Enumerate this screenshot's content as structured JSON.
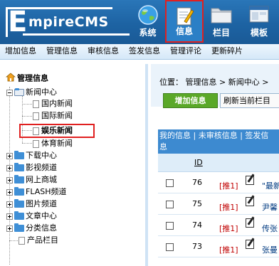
{
  "brand": {
    "logo_initial": "E",
    "logo_text": "mpireCMS"
  },
  "top_nav": [
    {
      "label": "系统",
      "icon": "globe-icon"
    },
    {
      "label": "信息",
      "icon": "notepad-icon",
      "active": true
    },
    {
      "label": "栏目",
      "icon": "folder-icon"
    },
    {
      "label": "模板",
      "icon": "window-icon"
    }
  ],
  "sub_menu": [
    "增加信息",
    "管理信息",
    "审核信息",
    "签发信息",
    "管理评论",
    "更新碎片"
  ],
  "tree": {
    "root_label": "管理信息",
    "news_center": "新闻中心",
    "news_children": [
      "国内新闻",
      "国际新闻",
      "娱乐新闻",
      "体育新闻"
    ],
    "selected": "娱乐新闻",
    "folders": [
      "下载中心",
      "影视频道",
      "网上商城",
      "FLASH频道",
      "图片频道",
      "文章中心",
      "分类信息"
    ],
    "last_item": "产品栏目"
  },
  "right": {
    "location": "位置： 管理信息 > 新闻中心 >",
    "add_button": "增加信息",
    "refresh_button": "刷新当前栏目",
    "tabs_line1": "我的信息 | 未审核信息 | 签发信",
    "tabs_line2": "息",
    "id_header": "ID",
    "rows": [
      {
        "id": "76",
        "tag": "[推1]",
        "title": "\"最新"
      },
      {
        "id": "75",
        "tag": "[推1]",
        "title": "尹馨"
      },
      {
        "id": "74",
        "tag": "[推1]",
        "title": "传张"
      },
      {
        "id": "73",
        "tag": "[推1]",
        "title": "张曼"
      }
    ]
  },
  "colors": {
    "header_blue": "#1d63a3",
    "highlight_red": "#e02020",
    "add_green": "#5aa828",
    "table_head": "#3d8ad0"
  }
}
